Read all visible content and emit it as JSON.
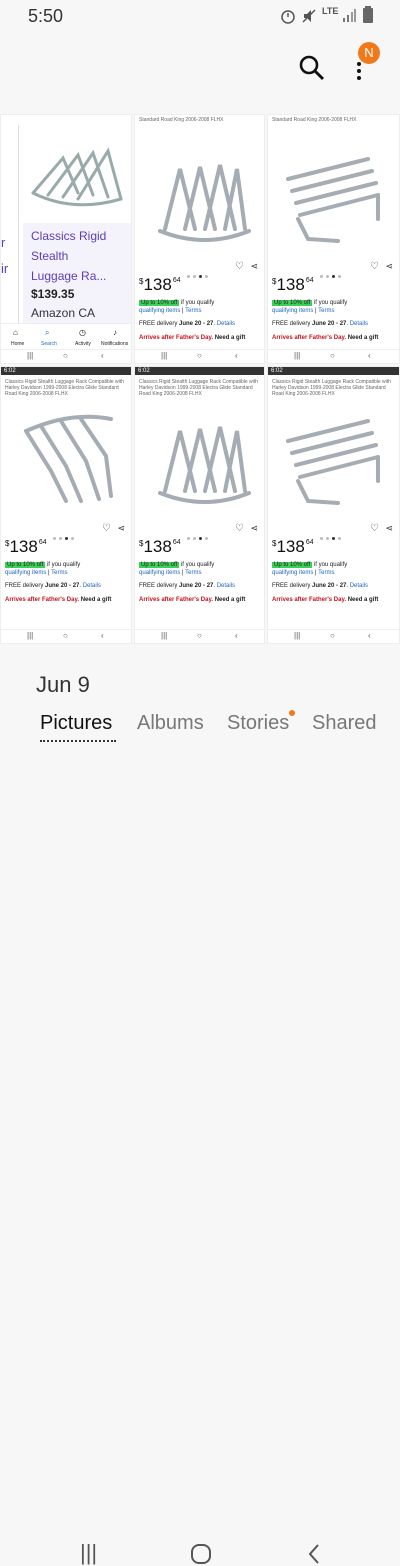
{
  "status": {
    "time": "5:50",
    "icons": [
      "alarm-icon",
      "mute-icon",
      "lte-icon",
      "signal-icon",
      "battery-icon"
    ],
    "lte": "LTE"
  },
  "toolbar": {
    "avatar_letter": "N"
  },
  "grid": {
    "first": {
      "title_line1": "Classics Rigid",
      "title_line2": "Stealth",
      "title_line3": "Luggage Ra...",
      "left_frag": "r",
      "left_frag2": "ir",
      "price": "$139.35",
      "store": "Amazon CA",
      "nav": [
        "Home",
        "Search",
        "Activity",
        "Notifications"
      ]
    },
    "cells": [
      {
        "caption": "Standard Road King 2006-2008 FLHX",
        "cur": "$",
        "price": "138",
        "cents": "64",
        "promo": "Up to 10% off",
        "promo_rest": "if you qualify",
        "qualify": "qualifying items",
        "sep": "|",
        "terms": "Terms",
        "delivery": "FREE delivery",
        "dates": "June 20 - 27",
        "details": "Details",
        "arrives": "Arrives after Father's Day.",
        "gift": "Need a gift"
      },
      {
        "caption": "Standard Road King 2006-2008 FLHX",
        "cur": "$",
        "price": "138",
        "cents": "64",
        "promo": "Up to 10% off",
        "promo_rest": "if you qualify",
        "qualify": "qualifying items",
        "sep": "|",
        "terms": "Terms",
        "delivery": "FREE delivery",
        "dates": "June 20 - 27",
        "details": "Details",
        "arrives": "Arrives after Father's Day.",
        "gift": "Need a gift"
      },
      {
        "status_time": "6:02",
        "caption": "Classics Rigid Stealth Luggage Rack Compatible with Harley Davidson 1999-2008 Electra Glide Standard Road King 2006-2008 FLHX",
        "cur": "$",
        "price": "138",
        "cents": "64",
        "promo": "Up to 10% off",
        "promo_rest": "if you qualify",
        "qualify": "qualifying items",
        "sep": "|",
        "terms": "Terms",
        "delivery": "FREE delivery",
        "dates": "June 20 - 27",
        "details": "Details",
        "arrives": "Arrives after Father's Day.",
        "gift": "Need a gift"
      },
      {
        "status_time": "6:02",
        "caption": "Classics Rigid Stealth Luggage Rack Compatible with Harley Davidson 1999-2008 Electra Glide Standard Road King 2006-2008 FLHX",
        "cur": "$",
        "price": "138",
        "cents": "64",
        "promo": "Up to 10% off",
        "promo_rest": "if you qualify",
        "qualify": "qualifying items",
        "sep": "|",
        "terms": "Terms",
        "delivery": "FREE delivery",
        "dates": "June 20 - 27",
        "details": "Details",
        "arrives": "Arrives after Father's Day.",
        "gift": "Need a gift"
      },
      {
        "status_time": "6:02",
        "caption": "Classics Rigid Stealth Luggage Rack Compatible with Harley Davidson 1999-2008 Electra Glide Standard Road King 2006-2008 FLHX",
        "cur": "$",
        "price": "138",
        "cents": "64",
        "promo": "Up to 10% off",
        "promo_rest": "if you qualify",
        "qualify": "qualifying items",
        "sep": "|",
        "terms": "Terms",
        "delivery": "FREE delivery",
        "dates": "June 20 - 27",
        "details": "Details",
        "arrives": "Arrives after Father's Day.",
        "gift": "Need a gift"
      }
    ]
  },
  "date_label": "Jun 9",
  "tabs": [
    "Pictures",
    "Albums",
    "Stories",
    "Shared"
  ],
  "colors": {
    "accent": "#f07a1a",
    "promo": "#3ecf5a",
    "link": "#1f66c1",
    "arrives": "#c5111e"
  }
}
